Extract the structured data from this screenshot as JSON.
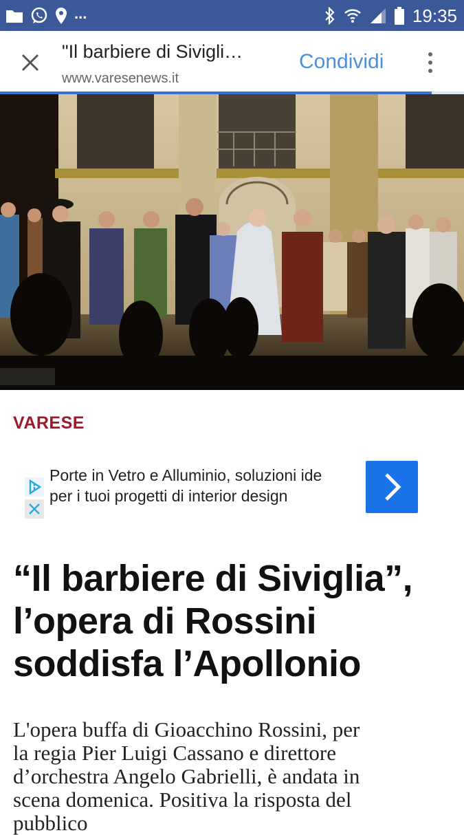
{
  "status_bar": {
    "time": "19:35",
    "overflow": "...",
    "left_icons": [
      "folder-icon",
      "whatsapp-icon",
      "location-icon"
    ],
    "right_icons": [
      "bluetooth-icon",
      "wifi-icon",
      "signal-icon",
      "battery-icon"
    ],
    "background": "#3b5998"
  },
  "browser": {
    "title": "\"Il barbiere di Sivigli…",
    "url": "www.varesenews.it",
    "share_label": "Condividi",
    "accent": "#4a8fdc"
  },
  "hero": {
    "icon": "photo-opera-stage"
  },
  "article": {
    "category": "VARESE",
    "category_color": "#9b1b2a",
    "headline_lines": [
      "“Il barbiere di Siviglia”,",
      "l’opera di Rossini",
      "soddisfa l’Apollonio"
    ],
    "lead_lines": [
      "L'opera buffa di Gioacchino Rossini, per",
      "la regia Pier Luigi Cassano e direttore",
      "d’orchestra Angelo Gabrielli, è andata in",
      "scena domenica. Positiva la risposta del",
      "pubblico"
    ]
  },
  "ad": {
    "line1": "Porte in Vetro e Alluminio, soluzioni ide",
    "line2": "per i tuoi progetti di interior design",
    "button_color": "#1a73e8"
  }
}
